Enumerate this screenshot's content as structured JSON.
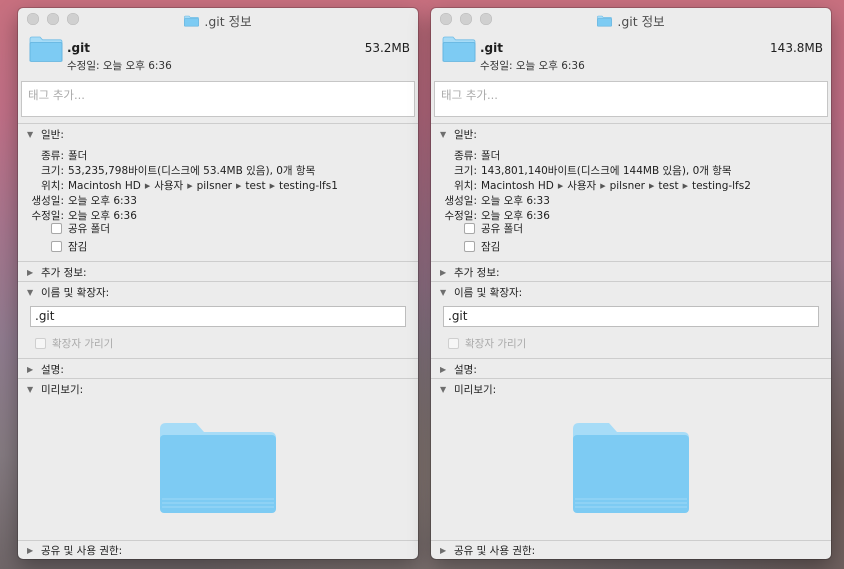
{
  "windows": [
    {
      "title": ".git 정보",
      "name": ".git",
      "modified_label": "수정일:",
      "modified_value": "오늘 오후 6:36",
      "size_header": "53.2MB",
      "tags_placeholder": "태그 추가...",
      "general_label": "일반:",
      "kind_label": "종류:",
      "kind_value": "폴더",
      "size_label": "크기:",
      "size_value": "53,235,798바이트(디스크에 53.4MB 있음), 0개 항목",
      "where_label": "위치:",
      "path": [
        "Macintosh HD",
        "사용자",
        "pilsner",
        "test",
        "testing-lfs1"
      ],
      "created_label": "생성일:",
      "created_value": "오늘 오후 6:33",
      "modified2_label": "수정일:",
      "modified2_value": "오늘 오후 6:36",
      "shared_folder_label": "공유 폴더",
      "locked_label": "잠김",
      "more_info_label": "추가 정보:",
      "name_ext_label": "이름 및 확장자:",
      "name_field_value": ".git",
      "hide_ext_label": "확장자 가리기",
      "comments_label": "설명:",
      "preview_label": "미리보기:",
      "sharing_label": "공유 및 사용 권한:"
    },
    {
      "title": ".git 정보",
      "name": ".git",
      "modified_label": "수정일:",
      "modified_value": "오늘 오후 6:36",
      "size_header": "143.8MB",
      "tags_placeholder": "태그 추가...",
      "general_label": "일반:",
      "kind_label": "종류:",
      "kind_value": "폴더",
      "size_label": "크기:",
      "size_value": "143,801,140바이트(디스크에 144MB 있음), 0개 항목",
      "where_label": "위치:",
      "path": [
        "Macintosh HD",
        "사용자",
        "pilsner",
        "test",
        "testing-lfs2"
      ],
      "created_label": "생성일:",
      "created_value": "오늘 오후 6:33",
      "modified2_label": "수정일:",
      "modified2_value": "오늘 오후 6:36",
      "shared_folder_label": "공유 폴더",
      "locked_label": "잠김",
      "more_info_label": "추가 정보:",
      "name_ext_label": "이름 및 확장자:",
      "name_field_value": ".git",
      "hide_ext_label": "확장자 가리기",
      "comments_label": "설명:",
      "preview_label": "미리보기:",
      "sharing_label": "공유 및 사용 권한:"
    }
  ],
  "icons": {
    "folder": "folder-icon",
    "disclosure_open": "triangle-down-icon",
    "disclosure_closed": "triangle-right-icon",
    "path_separator": "triangle-right-icon"
  },
  "colors": {
    "folder_front": "#7dcbf3",
    "folder_back": "#a7dcf7",
    "window_bg": "#ececec"
  }
}
